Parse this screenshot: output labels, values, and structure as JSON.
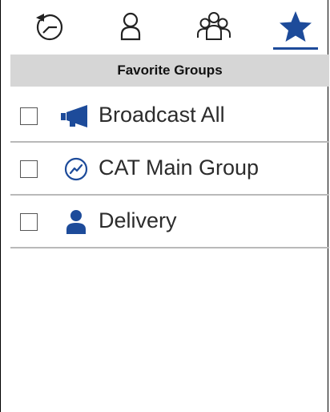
{
  "colors": {
    "accent": "#1d4b9a",
    "header_bg": "#d6d6d6",
    "divider": "#b9b9b9"
  },
  "tabs": [
    {
      "icon": "history-icon",
      "selected": false
    },
    {
      "icon": "contact-icon",
      "selected": false
    },
    {
      "icon": "groups-icon",
      "selected": false
    },
    {
      "icon": "star-icon",
      "selected": true
    }
  ],
  "section": {
    "title": "Favorite Groups"
  },
  "groups": [
    {
      "label": "Broadcast All",
      "icon": "megaphone-icon",
      "checked": false
    },
    {
      "label": "CAT Main Group",
      "icon": "trending-circle-icon",
      "checked": false
    },
    {
      "label": "Delivery",
      "icon": "person-icon",
      "checked": false
    }
  ]
}
